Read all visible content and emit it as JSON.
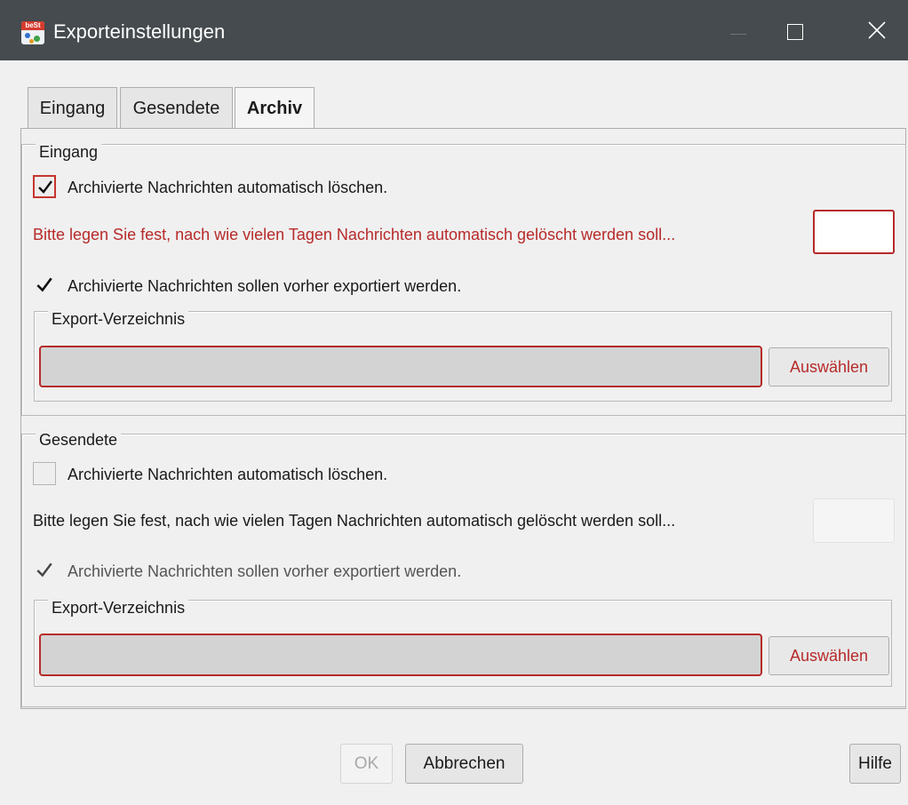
{
  "window": {
    "title": "Exporteinstellungen",
    "icon": "best-app-icon",
    "icon_text": "beSt"
  },
  "tabs": [
    {
      "label": "Eingang",
      "active": false
    },
    {
      "label": "Gesendete",
      "active": false
    },
    {
      "label": "Archiv",
      "active": true
    }
  ],
  "groups": [
    {
      "title": "Eingang",
      "auto_delete": {
        "label": "Archivierte Nachrichten automatisch löschen.",
        "checked": true
      },
      "days_prompt": "Bitte legen Sie fest, nach wie vielen Tagen Nachrichten automatisch gelöscht werden soll...",
      "days_value": "",
      "export_first": {
        "label": "Archivierte Nachrichten sollen vorher exportiert werden.",
        "checked": true
      },
      "export_dir": {
        "title": "Export-Verzeichnis",
        "value": "",
        "button": "Auswählen"
      }
    },
    {
      "title": "Gesendete",
      "auto_delete": {
        "label": "Archivierte Nachrichten automatisch löschen.",
        "checked": false
      },
      "days_prompt": "Bitte legen Sie fest, nach wie vielen Tagen Nachrichten automatisch gelöscht werden soll...",
      "days_value": "",
      "export_first": {
        "label": "Archivierte Nachrichten sollen vorher exportiert werden.",
        "checked": true
      },
      "export_dir": {
        "title": "Export-Verzeichnis",
        "value": "",
        "button": "Auswählen"
      }
    }
  ],
  "footer": {
    "ok": "OK",
    "cancel": "Abbrechen",
    "help": "Hilfe"
  },
  "colors": {
    "titlebar": "#454b4e",
    "error": "#b72a2a",
    "background": "#f0f0f0"
  }
}
